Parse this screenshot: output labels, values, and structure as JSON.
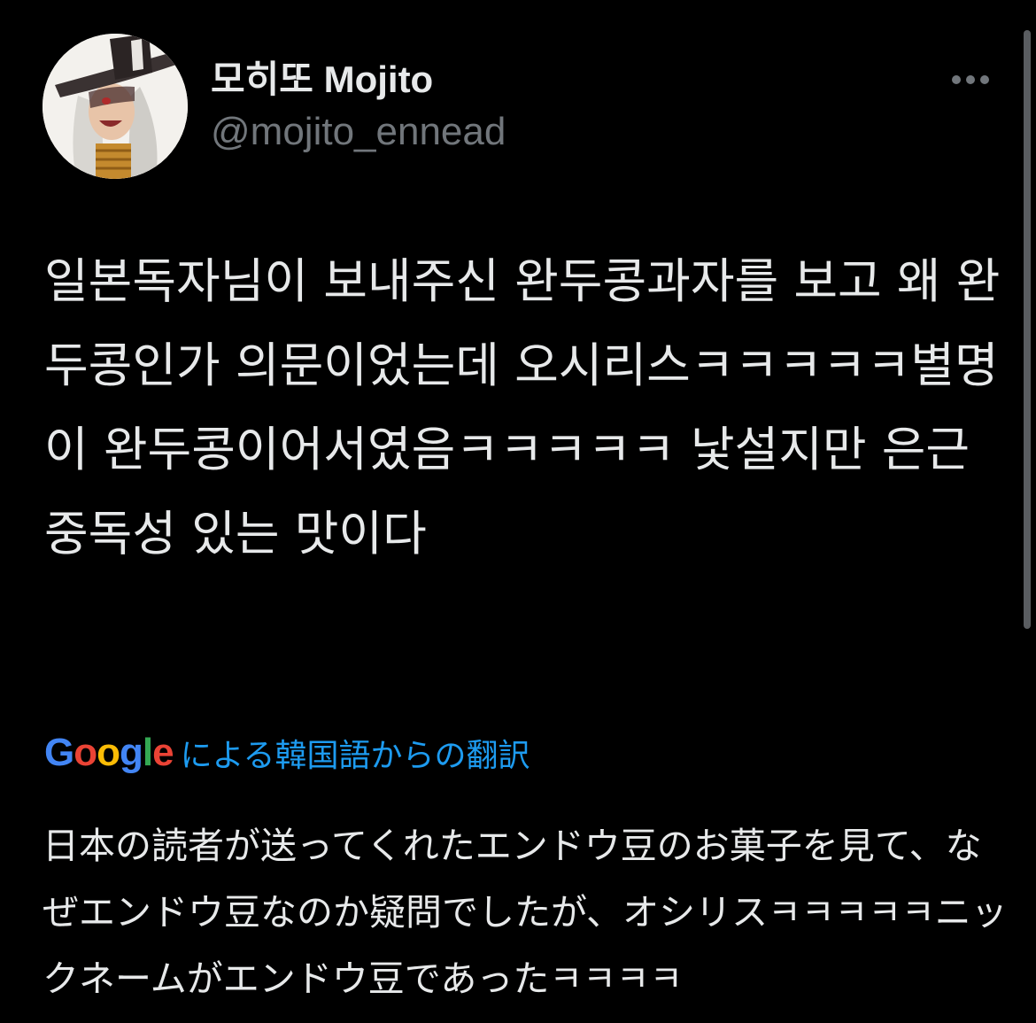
{
  "author": {
    "display_name": "모히또 Mojito",
    "handle": "@mojito_ennead",
    "avatar_icon": "avatar-hat-figure"
  },
  "more_icon": "more-horizontal-icon",
  "tweet_text": "일본독자님이 보내주신 완두콩과자를 보고 왜 완두콩인가 의문이었는데 오시리스ㅋㅋㅋㅋㅋ별명이 완두콩이어서였음ㅋㅋㅋㅋㅋ 낯설지만 은근 중독성 있는 맛이다",
  "translation": {
    "logo_text": "Google",
    "label": "による韓国語からの翻訳",
    "text": "日本の読者が送ってくれたエンドウ豆のお菓子を見て、なぜエンドウ豆なのか疑問でしたが、オシリスㅋㅋㅋㅋㅋニックネームがエンドウ豆であったㅋㅋㅋㅋ",
    "link_color": "#1d9bf0"
  },
  "colors": {
    "background": "#000000",
    "primary_text": "#e7e9ea",
    "secondary_text": "#71767b"
  }
}
